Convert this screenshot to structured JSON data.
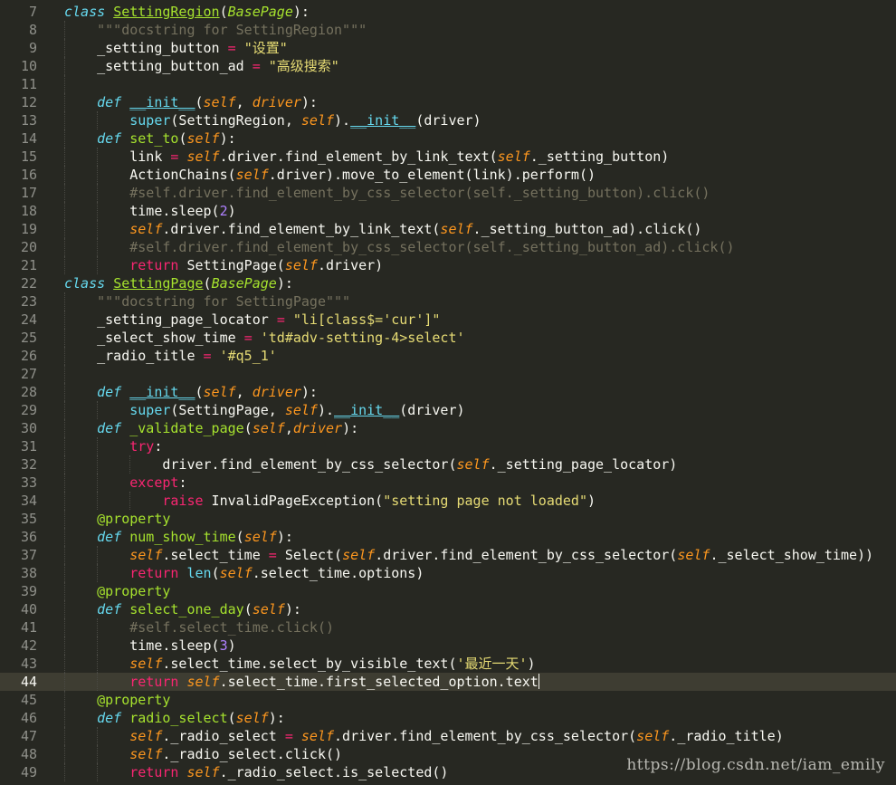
{
  "editor": {
    "current_line": 44,
    "lines": [
      {
        "n": "7",
        "indent": 0,
        "tokens": [
          [
            "kw",
            "class"
          ],
          [
            "p",
            " "
          ],
          [
            "cls",
            "SettingRegion"
          ],
          [
            "p",
            "("
          ],
          [
            "base",
            "BasePage"
          ],
          [
            "p",
            "):"
          ]
        ]
      },
      {
        "n": "8",
        "indent": 1,
        "tokens": [
          [
            "com",
            "    \"\"\"docstring for SettingRegion\"\"\""
          ]
        ]
      },
      {
        "n": "9",
        "indent": 1,
        "tokens": [
          [
            "p",
            "    _setting_button "
          ],
          [
            "op",
            "="
          ],
          [
            "p",
            " "
          ],
          [
            "str",
            "\"设置\""
          ]
        ]
      },
      {
        "n": "10",
        "indent": 1,
        "tokens": [
          [
            "p",
            "    _setting_button_ad "
          ],
          [
            "op",
            "="
          ],
          [
            "p",
            " "
          ],
          [
            "str",
            "\"高级搜索\""
          ]
        ]
      },
      {
        "n": "11",
        "indent": 1,
        "tokens": []
      },
      {
        "n": "12",
        "indent": 1,
        "tokens": [
          [
            "p",
            "    "
          ],
          [
            "kw",
            "def"
          ],
          [
            "p",
            " "
          ],
          [
            "mag",
            "__init__"
          ],
          [
            "p",
            "("
          ],
          [
            "self",
            "self"
          ],
          [
            "p",
            ", "
          ],
          [
            "self",
            "driver"
          ],
          [
            "p",
            "):"
          ]
        ]
      },
      {
        "n": "13",
        "indent": 2,
        "tokens": [
          [
            "p",
            "        "
          ],
          [
            "bi",
            "super"
          ],
          [
            "p",
            "(SettingRegion, "
          ],
          [
            "self",
            "self"
          ],
          [
            "p",
            ")."
          ],
          [
            "mag",
            "__init__"
          ],
          [
            "p",
            "(driver)"
          ]
        ]
      },
      {
        "n": "14",
        "indent": 1,
        "tokens": [
          [
            "p",
            "    "
          ],
          [
            "kw",
            "def"
          ],
          [
            "p",
            " "
          ],
          [
            "fn",
            "set_to"
          ],
          [
            "p",
            "("
          ],
          [
            "self",
            "self"
          ],
          [
            "p",
            "):"
          ]
        ]
      },
      {
        "n": "15",
        "indent": 2,
        "tokens": [
          [
            "p",
            "        link "
          ],
          [
            "op",
            "="
          ],
          [
            "p",
            " "
          ],
          [
            "self",
            "self"
          ],
          [
            "p",
            ".driver.find_element_by_link_text("
          ],
          [
            "self",
            "self"
          ],
          [
            "p",
            "._setting_button)"
          ]
        ]
      },
      {
        "n": "16",
        "indent": 2,
        "tokens": [
          [
            "p",
            "        ActionChains("
          ],
          [
            "self",
            "self"
          ],
          [
            "p",
            ".driver).move_to_element(link).perform()"
          ]
        ]
      },
      {
        "n": "17",
        "indent": 2,
        "tokens": [
          [
            "com",
            "        #self.driver.find_element_by_css_selector(self._setting_button).click()"
          ]
        ]
      },
      {
        "n": "18",
        "indent": 2,
        "tokens": [
          [
            "p",
            "        time.sleep("
          ],
          [
            "num",
            "2"
          ],
          [
            "p",
            ")"
          ]
        ]
      },
      {
        "n": "19",
        "indent": 2,
        "tokens": [
          [
            "p",
            "        "
          ],
          [
            "self",
            "self"
          ],
          [
            "p",
            ".driver.find_element_by_link_text("
          ],
          [
            "self",
            "self"
          ],
          [
            "p",
            "._setting_button_ad).click()"
          ]
        ]
      },
      {
        "n": "20",
        "indent": 2,
        "tokens": [
          [
            "com",
            "        #self.driver.find_element_by_css_selector(self._setting_button_ad).click()"
          ]
        ]
      },
      {
        "n": "21",
        "indent": 2,
        "tokens": [
          [
            "p",
            "        "
          ],
          [
            "ctl",
            "return"
          ],
          [
            "p",
            " SettingPage("
          ],
          [
            "self",
            "self"
          ],
          [
            "p",
            ".driver)"
          ]
        ]
      },
      {
        "n": "22",
        "indent": 0,
        "tokens": [
          [
            "kw",
            "class"
          ],
          [
            "p",
            " "
          ],
          [
            "cls",
            "SettingPage"
          ],
          [
            "p",
            "("
          ],
          [
            "base",
            "BasePage"
          ],
          [
            "p",
            "):"
          ]
        ]
      },
      {
        "n": "23",
        "indent": 1,
        "tokens": [
          [
            "com",
            "    \"\"\"docstring for SettingPage\"\"\""
          ]
        ]
      },
      {
        "n": "24",
        "indent": 1,
        "tokens": [
          [
            "p",
            "    _setting_page_locator "
          ],
          [
            "op",
            "="
          ],
          [
            "p",
            " "
          ],
          [
            "str",
            "\"li[class$='cur']\""
          ]
        ]
      },
      {
        "n": "25",
        "indent": 1,
        "tokens": [
          [
            "p",
            "    _select_show_time "
          ],
          [
            "op",
            "="
          ],
          [
            "p",
            " "
          ],
          [
            "str",
            "'td#adv-setting-4>select'"
          ]
        ]
      },
      {
        "n": "26",
        "indent": 1,
        "tokens": [
          [
            "p",
            "    _radio_title "
          ],
          [
            "op",
            "="
          ],
          [
            "p",
            " "
          ],
          [
            "str",
            "'#q5_1'"
          ]
        ]
      },
      {
        "n": "27",
        "indent": 1,
        "tokens": []
      },
      {
        "n": "28",
        "indent": 1,
        "tokens": [
          [
            "p",
            "    "
          ],
          [
            "kw",
            "def"
          ],
          [
            "p",
            " "
          ],
          [
            "mag",
            "__init__"
          ],
          [
            "p",
            "("
          ],
          [
            "self",
            "self"
          ],
          [
            "p",
            ", "
          ],
          [
            "self",
            "driver"
          ],
          [
            "p",
            "):"
          ]
        ]
      },
      {
        "n": "29",
        "indent": 2,
        "tokens": [
          [
            "p",
            "        "
          ],
          [
            "bi",
            "super"
          ],
          [
            "p",
            "(SettingPage, "
          ],
          [
            "self",
            "self"
          ],
          [
            "p",
            ")."
          ],
          [
            "mag",
            "__init__"
          ],
          [
            "p",
            "(driver)"
          ]
        ]
      },
      {
        "n": "30",
        "indent": 1,
        "tokens": [
          [
            "p",
            "    "
          ],
          [
            "kw",
            "def"
          ],
          [
            "p",
            " "
          ],
          [
            "fn",
            "_validate_page"
          ],
          [
            "p",
            "("
          ],
          [
            "self",
            "self"
          ],
          [
            "p",
            ","
          ],
          [
            "self",
            "driver"
          ],
          [
            "p",
            "):"
          ]
        ]
      },
      {
        "n": "31",
        "indent": 2,
        "tokens": [
          [
            "p",
            "        "
          ],
          [
            "ctl",
            "try"
          ],
          [
            "p",
            ":"
          ]
        ]
      },
      {
        "n": "32",
        "indent": 3,
        "tokens": [
          [
            "p",
            "            driver.find_element_by_css_selector("
          ],
          [
            "self",
            "self"
          ],
          [
            "p",
            "._setting_page_locator)"
          ]
        ]
      },
      {
        "n": "33",
        "indent": 2,
        "tokens": [
          [
            "p",
            "        "
          ],
          [
            "ctl",
            "except"
          ],
          [
            "p",
            ":"
          ]
        ]
      },
      {
        "n": "34",
        "indent": 3,
        "tokens": [
          [
            "p",
            "            "
          ],
          [
            "ctl",
            "raise"
          ],
          [
            "p",
            " InvalidPageException("
          ],
          [
            "str",
            "\"setting page not loaded\""
          ],
          [
            "p",
            ")"
          ]
        ]
      },
      {
        "n": "35",
        "indent": 1,
        "tokens": [
          [
            "p",
            "    "
          ],
          [
            "dec",
            "@property"
          ]
        ]
      },
      {
        "n": "36",
        "indent": 1,
        "tokens": [
          [
            "p",
            "    "
          ],
          [
            "kw",
            "def"
          ],
          [
            "p",
            " "
          ],
          [
            "fn",
            "num_show_time"
          ],
          [
            "p",
            "("
          ],
          [
            "self",
            "self"
          ],
          [
            "p",
            "):"
          ]
        ]
      },
      {
        "n": "37",
        "indent": 2,
        "tokens": [
          [
            "p",
            "        "
          ],
          [
            "self",
            "self"
          ],
          [
            "p",
            ".select_time "
          ],
          [
            "op",
            "="
          ],
          [
            "p",
            " Select("
          ],
          [
            "self",
            "self"
          ],
          [
            "p",
            ".driver.find_element_by_css_selector("
          ],
          [
            "self",
            "self"
          ],
          [
            "p",
            "._select_show_time))"
          ]
        ]
      },
      {
        "n": "38",
        "indent": 2,
        "tokens": [
          [
            "p",
            "        "
          ],
          [
            "ctl",
            "return"
          ],
          [
            "p",
            " "
          ],
          [
            "bi",
            "len"
          ],
          [
            "p",
            "("
          ],
          [
            "self",
            "self"
          ],
          [
            "p",
            ".select_time.options)"
          ]
        ]
      },
      {
        "n": "39",
        "indent": 1,
        "tokens": [
          [
            "p",
            "    "
          ],
          [
            "dec",
            "@property"
          ]
        ]
      },
      {
        "n": "40",
        "indent": 1,
        "tokens": [
          [
            "p",
            "    "
          ],
          [
            "kw",
            "def"
          ],
          [
            "p",
            " "
          ],
          [
            "fn",
            "select_one_day"
          ],
          [
            "p",
            "("
          ],
          [
            "self",
            "self"
          ],
          [
            "p",
            "):"
          ]
        ]
      },
      {
        "n": "41",
        "indent": 2,
        "tokens": [
          [
            "com",
            "        #self.select_time.click()"
          ]
        ]
      },
      {
        "n": "42",
        "indent": 2,
        "tokens": [
          [
            "p",
            "        time.sleep("
          ],
          [
            "num",
            "3"
          ],
          [
            "p",
            ")"
          ]
        ]
      },
      {
        "n": "43",
        "indent": 2,
        "tokens": [
          [
            "p",
            "        "
          ],
          [
            "self",
            "self"
          ],
          [
            "p",
            ".select_time.select_by_visible_text("
          ],
          [
            "str",
            "'最近一天'"
          ],
          [
            "p",
            ")"
          ]
        ]
      },
      {
        "n": "44",
        "indent": 2,
        "tokens": [
          [
            "p",
            "        "
          ],
          [
            "ctl",
            "return"
          ],
          [
            "p",
            " "
          ],
          [
            "self",
            "self"
          ],
          [
            "p",
            ".select_time.first_selected_option.text"
          ]
        ]
      },
      {
        "n": "45",
        "indent": 1,
        "tokens": [
          [
            "p",
            "    "
          ],
          [
            "dec",
            "@property"
          ]
        ]
      },
      {
        "n": "46",
        "indent": 1,
        "tokens": [
          [
            "p",
            "    "
          ],
          [
            "kw",
            "def"
          ],
          [
            "p",
            " "
          ],
          [
            "fn",
            "radio_select"
          ],
          [
            "p",
            "("
          ],
          [
            "self",
            "self"
          ],
          [
            "p",
            "):"
          ]
        ]
      },
      {
        "n": "47",
        "indent": 2,
        "tokens": [
          [
            "p",
            "        "
          ],
          [
            "self",
            "self"
          ],
          [
            "p",
            "._radio_select "
          ],
          [
            "op",
            "="
          ],
          [
            "p",
            " "
          ],
          [
            "self",
            "self"
          ],
          [
            "p",
            ".driver.find_element_by_css_selector("
          ],
          [
            "self",
            "self"
          ],
          [
            "p",
            "._radio_title)"
          ]
        ]
      },
      {
        "n": "48",
        "indent": 2,
        "tokens": [
          [
            "p",
            "        "
          ],
          [
            "self",
            "self"
          ],
          [
            "p",
            "._radio_select.click()"
          ]
        ]
      },
      {
        "n": "49",
        "indent": 2,
        "tokens": [
          [
            "p",
            "        "
          ],
          [
            "ctl",
            "return"
          ],
          [
            "p",
            " "
          ],
          [
            "self",
            "self"
          ],
          [
            "p",
            "._radio_select.is_selected()"
          ]
        ]
      }
    ]
  },
  "watermark": "https://blog.csdn.net/iam_emily",
  "colors": {
    "background": "#272822",
    "keyword": "#66d9ef",
    "function": "#a6e22e",
    "self": "#fd971f",
    "operator": "#f92672",
    "string": "#e6db74",
    "comment": "#75715e",
    "number": "#ae81ff"
  }
}
